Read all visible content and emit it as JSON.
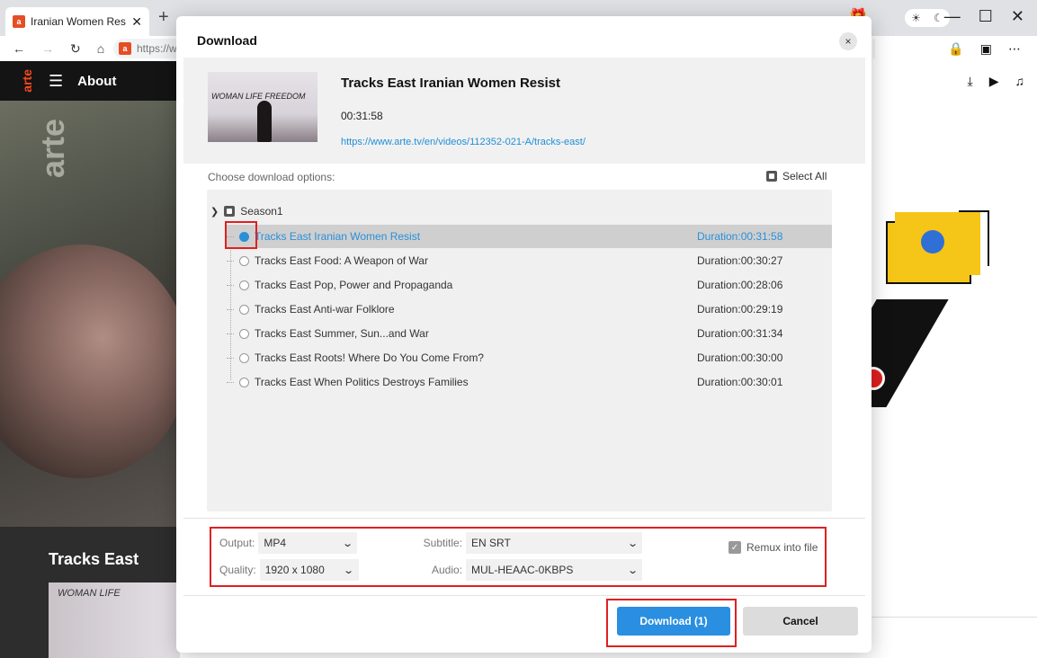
{
  "browser": {
    "tab_title": "Iranian Women Resist",
    "tab_close": "✕",
    "new_tab": "+",
    "url_text": "https://w",
    "window_controls": [
      "—",
      "☐",
      "✕"
    ],
    "theme_icons": [
      "☀",
      "☾"
    ]
  },
  "arte": {
    "logo": "arte",
    "nav_label": "About",
    "hero_logo": "arte",
    "show_title": "Tracks East",
    "show_thumb_text": "WOMAN  LIFE"
  },
  "dialog": {
    "title": "Download",
    "close": "×",
    "video": {
      "title": "Tracks East Iranian Women Resist",
      "duration": "00:31:58",
      "url": "https://www.arte.tv/en/videos/112352-021-A/tracks-east/",
      "thumb_text": "WOMAN  LIFE  FREEDOM"
    },
    "options_label": "Choose download options:",
    "select_all": "Select All",
    "season": "Season1",
    "episodes": [
      {
        "name": "Tracks East Iranian Women Resist",
        "duration": "Duration:00:31:58",
        "selected": true
      },
      {
        "name": "Tracks East Food: A Weapon of War",
        "duration": "Duration:00:30:27",
        "selected": false
      },
      {
        "name": "Tracks East Pop, Power and Propaganda",
        "duration": "Duration:00:28:06",
        "selected": false
      },
      {
        "name": "Tracks East Anti-war Folklore",
        "duration": "Duration:00:29:19",
        "selected": false
      },
      {
        "name": "Tracks East Summer, Sun...and War",
        "duration": "Duration:00:31:34",
        "selected": false
      },
      {
        "name": "Tracks East Roots! Where Do You Come From?",
        "duration": "Duration:00:30:00",
        "selected": false
      },
      {
        "name": "Tracks East When Politics Destroys Families",
        "duration": "Duration:00:30:01",
        "selected": false
      }
    ],
    "settings": {
      "output_label": "Output:",
      "output_value": "MP4",
      "quality_label": "Quality:",
      "quality_value": "1920 x 1080",
      "subtitle_label": "Subtitle:",
      "subtitle_value": "EN SRT",
      "audio_label": "Audio:",
      "audio_value": "MUL-HEAAC-0KBPS",
      "remux_label": "Remux into file",
      "remux_checked": true
    },
    "download_button": "Download (1)",
    "cancel_button": "Cancel"
  },
  "colors": {
    "accent": "#2a8fe0",
    "highlight_outline": "#e02020",
    "arte_orange": "#fa481c"
  }
}
